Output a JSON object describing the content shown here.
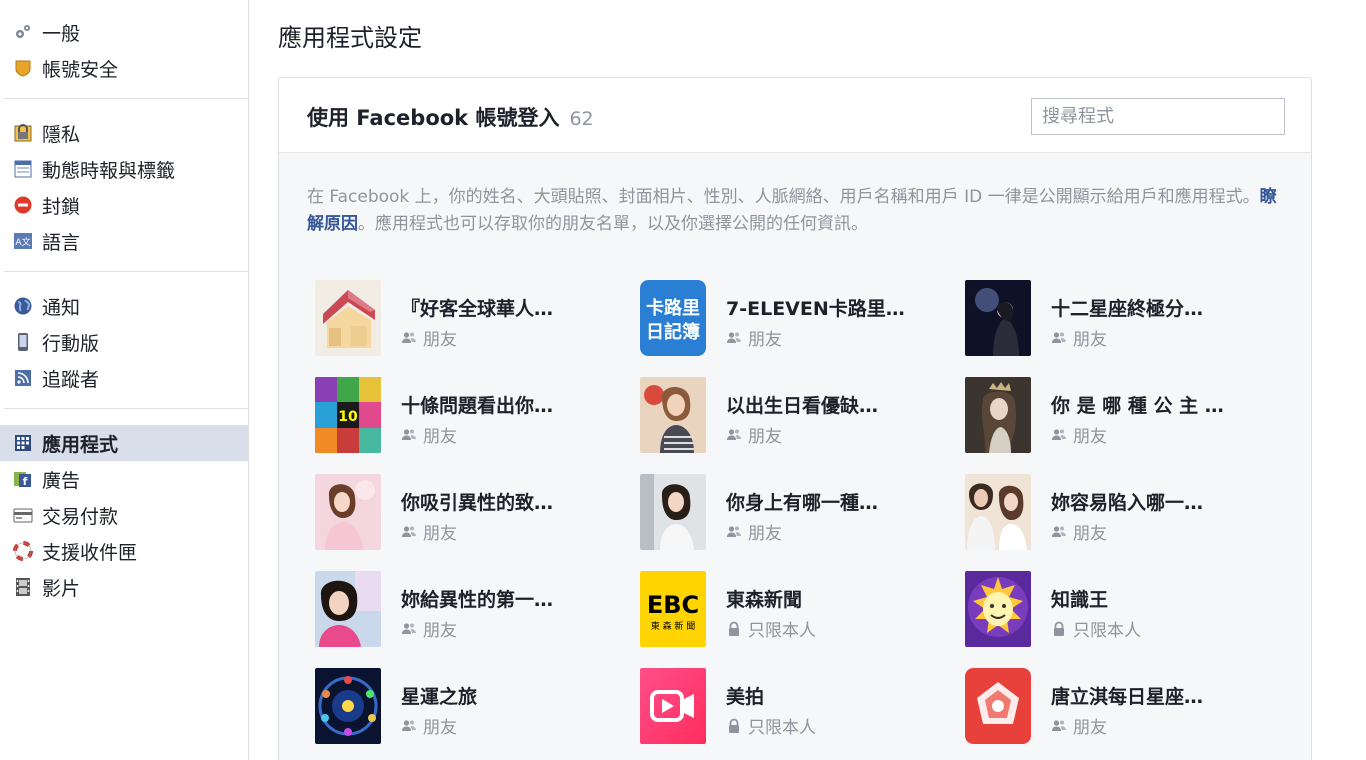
{
  "sidebar": {
    "groups": [
      [
        {
          "label": "一般",
          "icon": "gears-icon"
        },
        {
          "label": "帳號安全",
          "icon": "shield-icon"
        }
      ],
      [
        {
          "label": "隱私",
          "icon": "lock-icon"
        },
        {
          "label": "動態時報與標籤",
          "icon": "timeline-icon"
        },
        {
          "label": "封鎖",
          "icon": "block-icon"
        },
        {
          "label": "語言",
          "icon": "language-icon"
        }
      ],
      [
        {
          "label": "通知",
          "icon": "globe-icon"
        },
        {
          "label": "行動版",
          "icon": "mobile-icon"
        },
        {
          "label": "追蹤者",
          "icon": "rss-icon"
        }
      ],
      [
        {
          "label": "應用程式",
          "icon": "apps-icon",
          "active": true
        },
        {
          "label": "廣告",
          "icon": "ads-icon"
        },
        {
          "label": "交易付款",
          "icon": "payment-card-icon"
        },
        {
          "label": "支援收件匣",
          "icon": "lifebuoy-icon"
        },
        {
          "label": "影片",
          "icon": "film-icon"
        }
      ]
    ]
  },
  "main": {
    "title": "應用程式設定",
    "panel": {
      "title": "使用 Facebook 帳號登入",
      "count": "62",
      "search_placeholder": "搜尋程式",
      "desc_before": "在 Facebook 上，你的姓名、大頭貼照、封面相片、性別、人脈網絡、用戶名稱和用戶 ID 一律是公開顯示給用戶和應用程式。",
      "desc_link": "瞭解原因",
      "desc_after": "。應用程式也可以存取你的朋友名單，以及你選擇公開的任何資訊。"
    }
  },
  "apps": [
    {
      "name": "『好客全球華人…",
      "privacy": "朋友",
      "privacy_icon": "friends-icon",
      "thumb": "house-icon"
    },
    {
      "name": "7-ELEVEN卡路里…",
      "privacy": "朋友",
      "privacy_icon": "friends-icon",
      "thumb": "calorie-diary-logo",
      "logo_text": "卡路里日記簿"
    },
    {
      "name": "十二星座終極分…",
      "privacy": "朋友",
      "privacy_icon": "friends-icon",
      "thumb": "night-portrait"
    },
    {
      "name": "十條問題看出你…",
      "privacy": "朋友",
      "privacy_icon": "friends-icon",
      "thumb": "colorful-collage",
      "logo_text": "10"
    },
    {
      "name": "以出生日看優缺…",
      "privacy": "朋友",
      "privacy_icon": "friends-icon",
      "thumb": "girl-photo-1"
    },
    {
      "name": "你 是 哪 種 公 主 …",
      "privacy": "朋友",
      "privacy_icon": "friends-icon",
      "thumb": "princess-portrait"
    },
    {
      "name": "你吸引異性的致…",
      "privacy": "朋友",
      "privacy_icon": "friends-icon",
      "thumb": "girl-photo-2"
    },
    {
      "name": "你身上有哪一種…",
      "privacy": "朋友",
      "privacy_icon": "friends-icon",
      "thumb": "girl-photo-3"
    },
    {
      "name": "妳容易陷入哪一…",
      "privacy": "朋友",
      "privacy_icon": "friends-icon",
      "thumb": "couple-photo"
    },
    {
      "name": "妳給異性的第一…",
      "privacy": "朋友",
      "privacy_icon": "friends-icon",
      "thumb": "girl-photo-4"
    },
    {
      "name": "東森新聞",
      "privacy": "只限本人",
      "privacy_icon": "lock-icon",
      "thumb": "ebc-logo",
      "logo_text": "EBC",
      "logo_sub": "東 森 新 聞"
    },
    {
      "name": "知識王",
      "privacy": "只限本人",
      "privacy_icon": "lock-icon",
      "thumb": "bulb-character"
    },
    {
      "name": "星運之旅",
      "privacy": "朋友",
      "privacy_icon": "friends-icon",
      "thumb": "zodiac-wheel"
    },
    {
      "name": "美拍",
      "privacy": "只限本人",
      "privacy_icon": "lock-icon",
      "thumb": "meipai-logo"
    },
    {
      "name": "唐立淇每日星座…",
      "privacy": "朋友",
      "privacy_icon": "friends-icon",
      "thumb": "tang-logo"
    }
  ],
  "colors": {
    "link": "#365899",
    "muted": "#90949c",
    "active_bg": "#d8dfea",
    "panel_bg": "#f6f7f9"
  }
}
